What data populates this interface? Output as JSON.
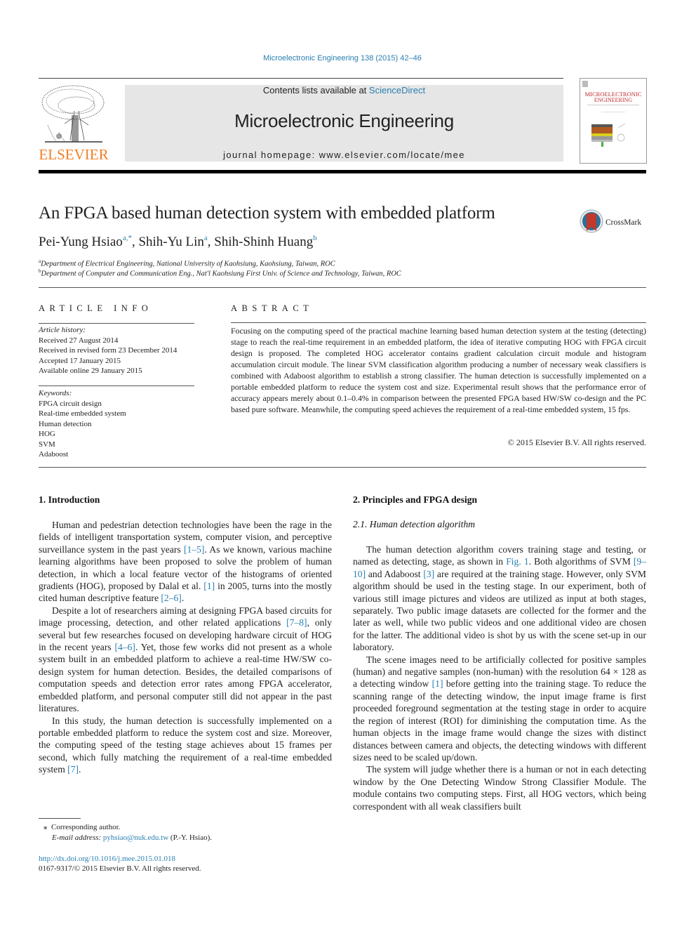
{
  "journal_ref": "Microelectronic Engineering 138 (2015) 42–46",
  "header": {
    "contents_prefix": "Contents lists available at ",
    "contents_link": "ScienceDirect",
    "journal_name": "Microelectronic Engineering",
    "homepage": "journal homepage: www.elsevier.com/locate/mee",
    "publisher_logo_text": "ELSEVIER",
    "cover_title_line1": "MICROELECTRONIC",
    "cover_title_line2": "ENGINEERING"
  },
  "colors": {
    "link": "#2a7fb0",
    "elsevier_orange": "#f07e26",
    "banner_gray": "#e6e6e6",
    "cover_red": "#c0282d"
  },
  "article": {
    "title": "An FPGA based human detection system with embedded platform",
    "crossmark_label": "CrossMark",
    "authors": [
      {
        "name": "Pei-Yung Hsiao",
        "sup": "a,*"
      },
      {
        "name": "Shih-Yu Lin",
        "sup": "a"
      },
      {
        "name": "Shih-Shinh Huang",
        "sup": "b"
      }
    ],
    "author_sep": ", ",
    "affiliations": [
      {
        "mark": "a",
        "text": "Department of Electrical Engineering, National University of Kaohsiung, Kaohsiung, Taiwan, ROC"
      },
      {
        "mark": "b",
        "text": "Department of Computer and Communication Eng., Nat'l Kaohsiung First Univ. of Science and Technology, Taiwan, ROC"
      }
    ]
  },
  "article_info": {
    "heading": "ARTICLE INFO",
    "history_label": "Article history:",
    "history": [
      "Received 27 August 2014",
      "Received in revised form 23 December 2014",
      "Accepted 17 January 2015",
      "Available online 29 January 2015"
    ],
    "keywords_label": "Keywords:",
    "keywords": [
      "FPGA circuit design",
      "Real-time embedded system",
      "Human detection",
      "HOG",
      "SVM",
      "Adaboost"
    ]
  },
  "abstract": {
    "heading": "ABSTRACT",
    "text": "Focusing on the computing speed of the practical machine learning based human detection system at the testing (detecting) stage to reach the real-time requirement in an embedded platform, the idea of iterative computing HOG with FPGA circuit design is proposed. The completed HOG accelerator contains gradient calculation circuit module and histogram accumulation circuit module. The linear SVM classification algorithm producing a number of necessary weak classifiers is combined with Adaboost algorithm to establish a strong classifier. The human detection is successfully implemented on a portable embedded platform to reduce the system cost and size. Experimental result shows that the performance error of accuracy appears merely about 0.1–0.4% in comparison between the presented FPGA based HW/SW co-design and the PC based pure software. Meanwhile, the computing speed achieves the requirement of a real-time embedded system, 15 fps.",
    "copyright": "© 2015 Elsevier B.V. All rights reserved."
  },
  "sections": {
    "intro": {
      "heading": "1. Introduction",
      "paragraphs": [
        [
          {
            "t": "Human and pedestrian detection technologies have been the rage in the fields of intelligent transportation system, computer vision, and perceptive surveillance system in the past years "
          },
          {
            "ref": "[1–5]"
          },
          {
            "t": ". As we known, various machine learning algorithms have been proposed to solve the problem of human detection, in which a local feature vector of the histograms of oriented gradients (HOG), proposed by Dalal et al. "
          },
          {
            "ref": "[1]"
          },
          {
            "t": " in 2005, turns into the mostly cited human descriptive feature "
          },
          {
            "ref": "[2–6]"
          },
          {
            "t": "."
          }
        ],
        [
          {
            "t": "Despite a lot of researchers aiming at designing FPGA based circuits for image processing, detection, and other related applications "
          },
          {
            "ref": "[7–8]"
          },
          {
            "t": ", only several but few researches focused on developing hardware circuit of HOG in the recent years "
          },
          {
            "ref": "[4–6]"
          },
          {
            "t": ". Yet, those few works did not present as a whole system built in an embedded platform to achieve a real-time HW/SW co-design system for human detection. Besides, the detailed comparisons of computation speeds and detection error rates among FPGA accelerator, embedded platform, and personal computer still did not appear in the past literatures."
          }
        ],
        [
          {
            "t": "In this study, the human detection is successfully implemented on a portable embedded platform to reduce the system cost and size. Moreover, the computing speed of the testing stage achieves about 15 frames per second, which fully matching the requirement of a real-time embedded system "
          },
          {
            "ref": "[7]"
          },
          {
            "t": "."
          }
        ]
      ]
    },
    "principles": {
      "heading": "2. Principles and FPGA design",
      "subheading": "2.1. Human detection algorithm",
      "paragraphs": [
        [
          {
            "t": "The human detection algorithm covers training stage and testing, or named as detecting, stage, as shown in "
          },
          {
            "ref": "Fig. 1"
          },
          {
            "t": ". Both algorithms of SVM "
          },
          {
            "ref": "[9–10]"
          },
          {
            "t": " and Adaboost "
          },
          {
            "ref": "[3]"
          },
          {
            "t": " are required at the training stage. However, only SVM algorithm should be used in the testing stage. In our experiment, both of various still image pictures and videos are utilized as input at both stages, separately. Two public image datasets are collected for the former and the later as well, while two public videos and one additional video are chosen for the latter. The additional video is shot by us with the scene set-up in our laboratory."
          }
        ],
        [
          {
            "t": "The scene images need to be artificially collected for positive samples (human) and negative samples (non-human) with the resolution 64 × 128 as a detecting window "
          },
          {
            "ref": "[1]"
          },
          {
            "t": " before getting into the training stage. To reduce the scanning range of the detecting window, the input image frame is first proceeded foreground segmentation at the testing stage in order to acquire the region of interest (ROI) for diminishing the computation time. As the human objects in the image frame would change the sizes with distinct distances between camera and objects, the detecting windows with different sizes need to be scaled up/down."
          }
        ],
        [
          {
            "t": "The system will judge whether there is a human or not in each detecting window by the One Detecting Window Strong Classifier Module. The module contains two computing steps. First, all HOG vectors, which being correspondent with all weak classifiers built"
          }
        ]
      ]
    }
  },
  "footnotes": {
    "star": "⁎",
    "corresponding": "Corresponding author.",
    "email_label": "E-mail address:",
    "email": "pyhsiao@nuk.edu.tw",
    "email_suffix": " (P.-Y. Hsiao).",
    "doi": "http://dx.doi.org/10.1016/j.mee.2015.01.018",
    "issn": "0167-9317/© 2015 Elsevier B.V. All rights reserved."
  }
}
